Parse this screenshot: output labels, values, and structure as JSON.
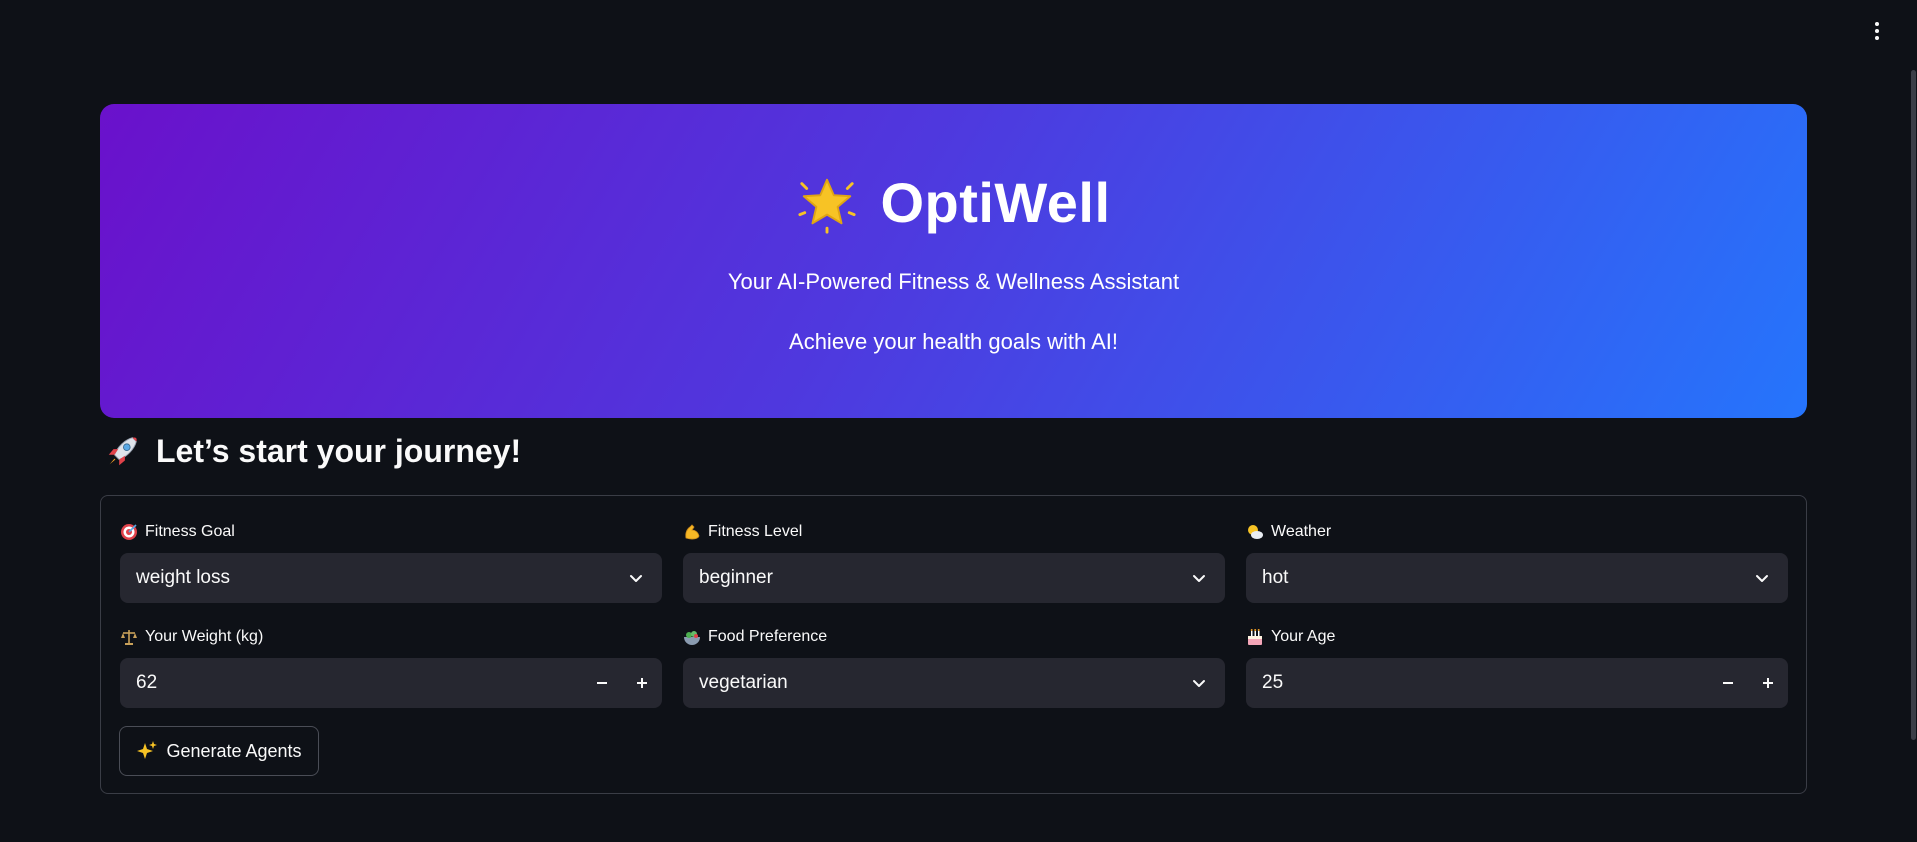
{
  "hero": {
    "title": "OptiWell",
    "subtitle": "Your AI-Powered Fitness & Wellness Assistant",
    "tagline": "Achieve your health goals with AI!",
    "icon": "star-icon",
    "gradient_start": "#6a11cb",
    "gradient_end": "#2575fc"
  },
  "section": {
    "title": "Let’s start your journey!",
    "icon": "rocket-icon"
  },
  "form": {
    "fitness_goal": {
      "label": "Fitness Goal",
      "value": "weight loss",
      "icon": "target-icon"
    },
    "fitness_level": {
      "label": "Fitness Level",
      "value": "beginner",
      "icon": "flexed-biceps-icon"
    },
    "weather": {
      "label": "Weather",
      "value": "hot",
      "icon": "sun-cloud-icon"
    },
    "weight": {
      "label": "Your Weight (kg)",
      "value": "62",
      "icon": "balance-scale-icon"
    },
    "food_preference": {
      "label": "Food Preference",
      "value": "vegetarian",
      "icon": "salad-icon"
    },
    "age": {
      "label": "Your Age",
      "value": "25",
      "icon": "birthday-cake-icon"
    }
  },
  "actions": {
    "generate_label": "Generate Agents",
    "generate_icon": "sparkles-icon"
  },
  "colors": {
    "background": "#0e1117",
    "input_bg": "#262730",
    "border": "#3a3d46"
  }
}
